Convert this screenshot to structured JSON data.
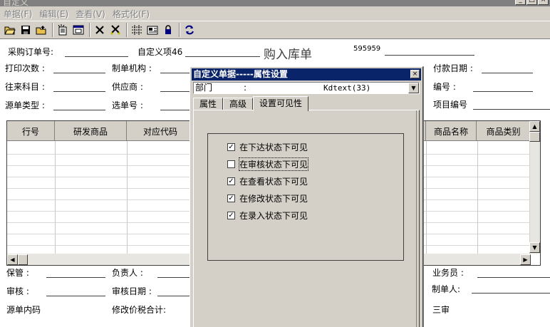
{
  "window": {
    "title": "自定义"
  },
  "menu": [
    "单据(F)",
    "编辑(E)",
    "查看(V)",
    "格式化(F)"
  ],
  "form": {
    "title": "购入库单",
    "number": "595959",
    "labels": {
      "po_no": "采购订单号:",
      "custom46": "自定义项46",
      "print_count": "打印次数 :",
      "creator_org": "制单机构 :",
      "pay_date": "付款日期 :",
      "account": "往来科目 :",
      "supplier": "供应商 :",
      "code": "编号 :",
      "src_type": "源单类型 :",
      "sel_no": "选单号 :",
      "project_no": "项目编号",
      "keeper": "保管 :",
      "manager": "负责人 :",
      "salesman": "业务员 :",
      "auditor": "审核 :",
      "audit_date": "审核日期 :",
      "maker": "制单人:",
      "src_content": "源单内码",
      "modify_tax": "修改价税合计:",
      "third": "三审"
    },
    "grid_headers": [
      "行号",
      "研发商品",
      "对应代码",
      "商品名称",
      "商品类别"
    ]
  },
  "dialog": {
    "title": "自定义单据-----属性设置",
    "field": "部门",
    "colon": ":",
    "type": "Kdtext(33)",
    "tabs": [
      "属性",
      "高级",
      "设置可见性"
    ],
    "checks": [
      {
        "label": "在下达状态下可见",
        "checked": true
      },
      {
        "label": "在审核状态下可见",
        "checked": false
      },
      {
        "label": "在查看状态下可见",
        "checked": true
      },
      {
        "label": "在修改状态下可见",
        "checked": true
      },
      {
        "label": "在录入状态下可见",
        "checked": true
      }
    ]
  }
}
